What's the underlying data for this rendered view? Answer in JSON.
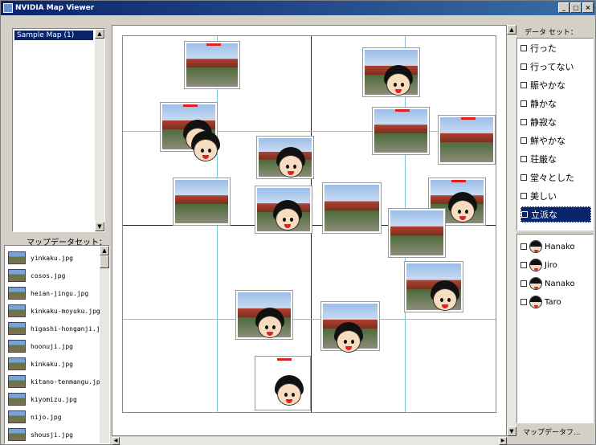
{
  "window": {
    "title": "NVIDIA Map Viewer",
    "min": "_",
    "max": "□",
    "close": "×"
  },
  "map_list": {
    "items": [
      "Sample Map (1)"
    ]
  },
  "map_data_label": "マップデータセット：",
  "files": [
    "yinkaku.jpg",
    "cosos.jpg",
    "heian-jingu.jpg",
    "kinkaku-moyuku.jpg",
    "higashi-honganji.jpg",
    "hoonuji.jpg",
    "kinkaku.jpg",
    "kitano-tenmangu.jpg",
    "kiyomizu.jpg",
    "nijo.jpg",
    "shousji.jpg"
  ],
  "data_set_label": "データ セット：",
  "keywords": [
    "行った",
    "行ってない",
    "賑やかな",
    "静かな",
    "静寂な",
    "鮮やかな",
    "荘厳な",
    "堂々とした",
    "美しい",
    "立派な"
  ],
  "selected_keyword": "立派な",
  "people": [
    "Hanako",
    "Jiro",
    "Nanako",
    "Taro"
  ],
  "bottom_label": "マップデータフ..."
}
